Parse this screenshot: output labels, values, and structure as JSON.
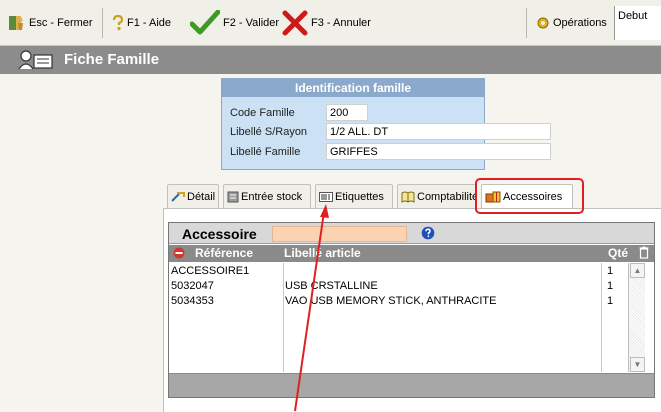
{
  "toolbar": {
    "esc_label": "Esc - Fermer",
    "f1_label": "F1 - Aide",
    "f2_label": "F2 - Valider",
    "f3_label": "F3 - Annuler",
    "operations_label": "Opérations",
    "debut_label": "Debut"
  },
  "title": "Fiche Famille",
  "identification": {
    "header": "Identification famille",
    "code_label": "Code Famille",
    "code_value": "200",
    "rayon_label": "Libellé S/Rayon",
    "rayon_value": "1/2 ALL. DT",
    "famille_label": "Libellé Famille",
    "famille_value": "GRIFFES"
  },
  "tabs": [
    {
      "label": "Détail"
    },
    {
      "label": "Entrée stock"
    },
    {
      "label": "Etiquettes"
    },
    {
      "label": "Comptabilité"
    },
    {
      "label": "Accessoires"
    }
  ],
  "accessoires": {
    "search_label": "Accessoire",
    "search_value": "",
    "col_reference": "Référence",
    "col_libelle": "Libellé article",
    "col_qte": "Qté",
    "rows": [
      {
        "reference": "ACCESSOIRE1",
        "libelle": "",
        "qte": "1"
      },
      {
        "reference": "5032047",
        "libelle": "USB CRSTALLINE",
        "qte": "1"
      },
      {
        "reference": "5034353",
        "libelle": "VAO USB MEMORY STICK, ANTHRACITE",
        "qte": "1"
      }
    ]
  },
  "colors": {
    "annotation": "#e02020",
    "search_input": "#fbd3b3",
    "ident_bg": "#cde1f4"
  }
}
